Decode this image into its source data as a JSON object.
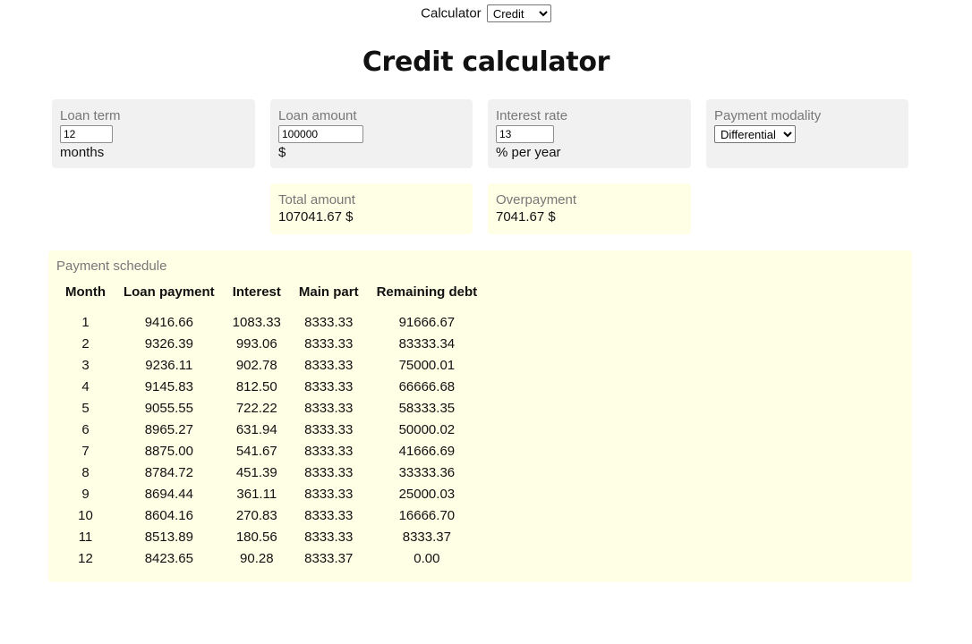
{
  "header": {
    "calculator_label": "Calculator",
    "calculator_selected": "Credit",
    "title": "Credit calculator"
  },
  "inputs": {
    "loan_term": {
      "label": "Loan term",
      "value": "12",
      "unit": "months"
    },
    "loan_amount": {
      "label": "Loan amount",
      "value": "100000",
      "unit": "$"
    },
    "interest_rate": {
      "label": "Interest rate",
      "value": "13",
      "unit": "% per year"
    },
    "payment_modality": {
      "label": "Payment modality",
      "selected": "Differential"
    }
  },
  "results": {
    "total_amount": {
      "label": "Total amount",
      "value": "107041.67 $"
    },
    "overpayment": {
      "label": "Overpayment",
      "value": "7041.67 $"
    }
  },
  "schedule": {
    "title": "Payment schedule",
    "columns": [
      "Month",
      "Loan payment",
      "Interest",
      "Main part",
      "Remaining debt"
    ],
    "rows": [
      [
        "1",
        "9416.66",
        "1083.33",
        "8333.33",
        "91666.67"
      ],
      [
        "2",
        "9326.39",
        "993.06",
        "8333.33",
        "83333.34"
      ],
      [
        "3",
        "9236.11",
        "902.78",
        "8333.33",
        "75000.01"
      ],
      [
        "4",
        "9145.83",
        "812.50",
        "8333.33",
        "66666.68"
      ],
      [
        "5",
        "9055.55",
        "722.22",
        "8333.33",
        "58333.35"
      ],
      [
        "6",
        "8965.27",
        "631.94",
        "8333.33",
        "50000.02"
      ],
      [
        "7",
        "8875.00",
        "541.67",
        "8333.33",
        "41666.69"
      ],
      [
        "8",
        "8784.72",
        "451.39",
        "8333.33",
        "33333.36"
      ],
      [
        "9",
        "8694.44",
        "361.11",
        "8333.33",
        "25000.03"
      ],
      [
        "10",
        "8604.16",
        "270.83",
        "8333.33",
        "16666.70"
      ],
      [
        "11",
        "8513.89",
        "180.56",
        "8333.33",
        "8333.37"
      ],
      [
        "12",
        "8423.65",
        "90.28",
        "8333.37",
        "0.00"
      ]
    ]
  },
  "colors": {
    "input_card_bg": "#f1f1f1",
    "result_card_bg": "#ffffe6",
    "label_gray": "#777777"
  }
}
